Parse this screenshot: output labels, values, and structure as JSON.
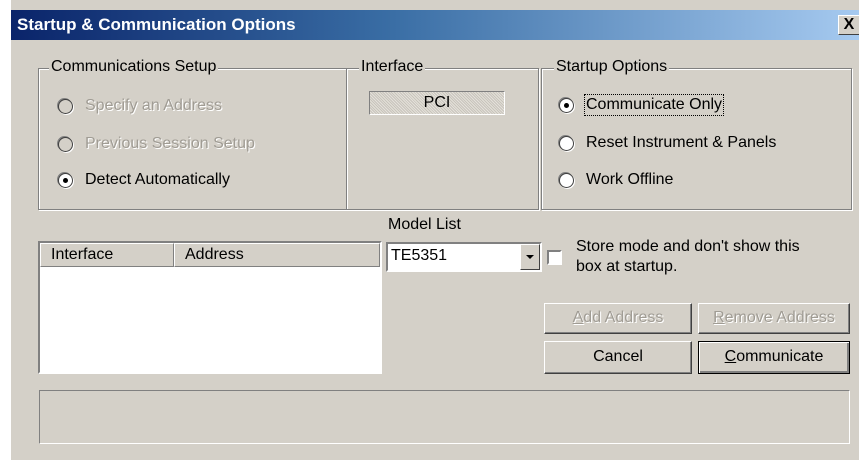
{
  "window": {
    "title": "Startup & Communication Options",
    "close_label": "X"
  },
  "communications_setup": {
    "label": "Communications Setup",
    "options": [
      {
        "label": "Specify an Address",
        "checked": false,
        "enabled": false
      },
      {
        "label": "Previous Session Setup",
        "checked": false,
        "enabled": false
      },
      {
        "label": "Detect Automatically",
        "checked": true,
        "enabled": true
      }
    ]
  },
  "interface_group": {
    "label": "Interface",
    "value": "PCI"
  },
  "startup_options": {
    "label": "Startup Options",
    "options": [
      {
        "label": "Communicate Only",
        "checked": true
      },
      {
        "label": "Reset Instrument & Panels",
        "checked": false
      },
      {
        "label": "Work Offline",
        "checked": false
      }
    ]
  },
  "address_list": {
    "columns": [
      "Interface",
      "Address"
    ],
    "rows": []
  },
  "model_list": {
    "label": "Model List",
    "selected": "TE5351"
  },
  "store_mode": {
    "line1": "Store mode and don't show this",
    "line2": "box at startup.",
    "checked": false
  },
  "buttons": {
    "add_address": {
      "mnemonic": "A",
      "rest": "dd Address",
      "enabled": false
    },
    "remove_address": {
      "mnemonic": "R",
      "rest": "emove Address",
      "enabled": false
    },
    "cancel": "Cancel",
    "communicate": {
      "mnemonic": "C",
      "rest": "ommunicate"
    }
  },
  "status_text": ""
}
